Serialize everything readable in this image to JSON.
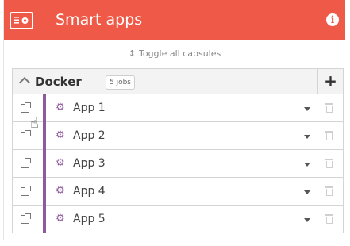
{
  "header": {
    "title": "Smart apps",
    "app_icon": "desktop-monitor-icon",
    "info_icon": "info-icon",
    "accent_color": "#ef5a48"
  },
  "toolbar": {
    "toggle_all_label": "Toggle all capsules",
    "toggle_icon": "up-down-arrow-icon"
  },
  "capsule": {
    "title": "Docker",
    "jobs_badge": "5 jobs",
    "add_icon": "plus-icon",
    "collapse_icon": "chevron-up-icon",
    "bar_color": "#8e5a9b",
    "rows": [
      {
        "label": "App 1"
      },
      {
        "label": "App 2"
      },
      {
        "label": "App 3"
      },
      {
        "label": "App 4"
      },
      {
        "label": "App 5"
      }
    ]
  }
}
